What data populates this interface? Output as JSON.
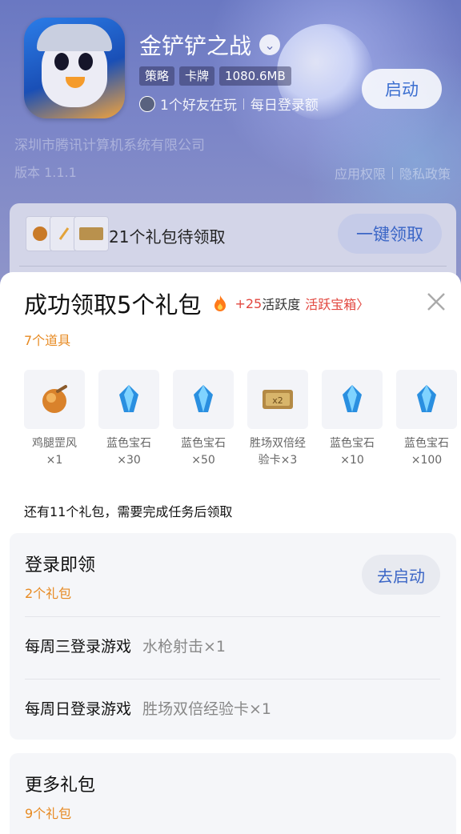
{
  "app": {
    "title": "金铲铲之战",
    "tags": [
      "策略",
      "卡牌",
      "1080.6MB"
    ],
    "friends_playing": "1个好友在玩",
    "daily_text": "每日登录额",
    "launch_label": "启动",
    "developer": "深圳市腾讯计算机系统有限公司",
    "version": "版本 1.1.1",
    "permissions_link": "应用权限",
    "privacy_link": "隐私政策"
  },
  "giftbar": {
    "pending_text": "21个礼包待领取",
    "collect_all_label": "一键领取"
  },
  "sheet": {
    "title": "成功领取5个礼包",
    "activity_plus": "+25",
    "activity_label": "活跃度",
    "chest_link": "活跃宝箱",
    "items_count": "7个道具",
    "items": [
      {
        "name": "鸡腿罡风",
        "qty": "×1",
        "icon": "drumstick-orb-icon"
      },
      {
        "name": "蓝色宝石",
        "qty": "×30",
        "icon": "blue-gem-icon"
      },
      {
        "name": "蓝色宝石",
        "qty": "×50",
        "icon": "blue-gem-icon"
      },
      {
        "name": "胜场双倍经验卡",
        "qty": "×3",
        "icon": "double-xp-card-icon"
      },
      {
        "name": "蓝色宝石",
        "qty": "×10",
        "icon": "blue-gem-icon"
      },
      {
        "name": "蓝色宝石",
        "qty": "×100",
        "icon": "blue-gem-icon"
      }
    ],
    "remaining_text": "还有11个礼包，需要完成任务后领取"
  },
  "login_card": {
    "title": "登录即领",
    "count": "2个礼包",
    "go_label": "去启动",
    "tasks": [
      {
        "name": "每周三登录游戏",
        "reward": "水枪射击×1"
      },
      {
        "name": "每周日登录游戏",
        "reward": "胜场双倍经验卡×1"
      }
    ]
  },
  "more_card": {
    "title": "更多礼包",
    "count": "9个礼包"
  },
  "colors": {
    "accent_blue": "#3b66c6",
    "orange": "#e78a22",
    "red": "#e2473f"
  }
}
